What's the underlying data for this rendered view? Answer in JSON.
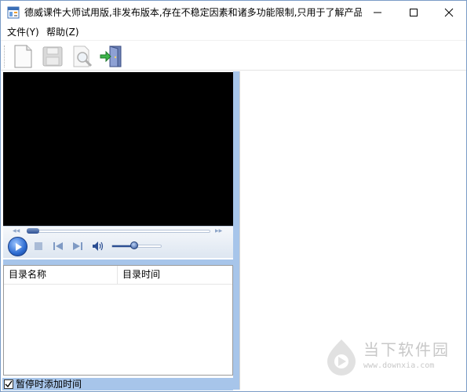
{
  "window": {
    "title": "德威课件大师试用版,非发布版本,存在不稳定因素和诸多功能限制,只用于了解产品,..."
  },
  "menu": {
    "file_label": "文件(Y)",
    "help_label": "帮助(Z)"
  },
  "toolbar": {
    "icons": [
      "new-document-icon",
      "save-icon",
      "print-preview-icon",
      "exit-door-icon"
    ]
  },
  "player": {
    "seek_position": 0.0,
    "volume": 0.45
  },
  "catalog_list": {
    "columns": [
      "目录名称",
      "目录时间"
    ],
    "rows": []
  },
  "options": {
    "add_time_on_pause_label": "暂停时添加时间",
    "add_time_on_pause_checked": true
  },
  "watermark": {
    "brand_text": "当下软件园",
    "url_text": "www.downxia.com"
  },
  "colors": {
    "splitter": "#a7c5ea",
    "video_background": "#000000",
    "player_accent": "#2d6cd1"
  }
}
